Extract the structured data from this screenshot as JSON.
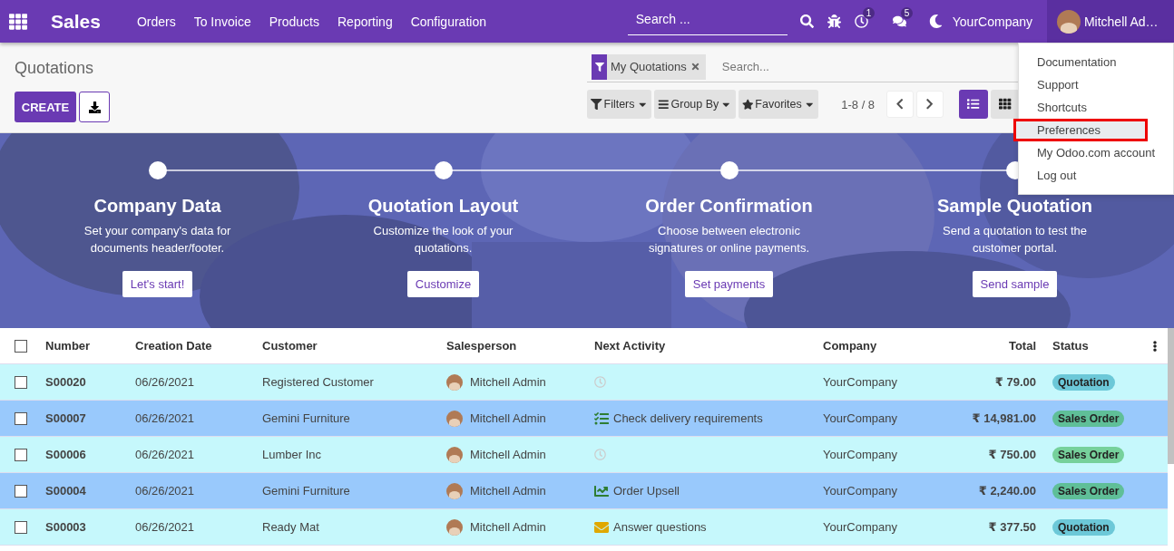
{
  "navbar": {
    "app_name": "Sales",
    "menu": [
      "Orders",
      "To Invoice",
      "Products",
      "Reporting",
      "Configuration"
    ],
    "search": {
      "placeholder": "Search ..."
    },
    "activity_count": "1",
    "message_count": "5",
    "company": "YourCompany",
    "user": "Mitchell Ad…"
  },
  "user_menu": [
    {
      "label": "Documentation",
      "selected": false
    },
    {
      "label": "Support",
      "selected": false
    },
    {
      "label": "Shortcuts",
      "selected": false
    },
    {
      "label": "Preferences",
      "selected": true
    },
    {
      "label": "My Odoo.com account",
      "selected": false
    },
    {
      "label": "Log out",
      "selected": false
    }
  ],
  "control_panel": {
    "title": "Quotations",
    "create_button": "CREATE",
    "facet": "My Quotations",
    "search_placeholder": "Search...",
    "filters": [
      "Filters",
      "Group By",
      "Favorites"
    ],
    "pager": "1-8 / 8",
    "views": [
      {
        "kind": "list",
        "selected": true
      },
      {
        "kind": "kanban",
        "selected": false
      }
    ]
  },
  "onboarding_steps": [
    {
      "title": "Company Data",
      "description": "Set your company's data for documents header/footer.",
      "button": "Let's start!"
    },
    {
      "title": "Quotation Layout",
      "description": "Customize the look of your quotations.",
      "button": "Customize"
    },
    {
      "title": "Order Confirmation",
      "description": "Choose between electronic signatures or online payments.",
      "button": "Set payments"
    },
    {
      "title": "Sample Quotation",
      "description": "Send a quotation to test the customer portal.",
      "button": "Send sample"
    }
  ],
  "table": {
    "select_all_checked": false,
    "columns": [
      "Number",
      "Creation Date",
      "Customer",
      "Salesperson",
      "Next Activity",
      "Company",
      "Total",
      "Status"
    ],
    "rows": [
      {
        "checked": false,
        "number": "S00020",
        "date": "06/26/2021",
        "customer": "Registered Customer",
        "salesperson": "Mitchell Admin",
        "activity": {
          "kind": "none"
        },
        "company": "YourCompany",
        "total": "₹ 79.00",
        "status": {
          "label": "Quotation",
          "color": "#6cc8d8"
        }
      },
      {
        "checked": false,
        "number": "S00007",
        "date": "06/26/2021",
        "customer": "Gemini Furniture",
        "salesperson": "Mitchell Admin",
        "activity": {
          "kind": "todo",
          "label": "Check delivery requirements"
        },
        "company": "YourCompany",
        "total": "₹ 14,981.00",
        "status": {
          "label": "Sales Order",
          "color": "#5fbf98"
        }
      },
      {
        "checked": false,
        "number": "S00006",
        "date": "06/26/2021",
        "customer": "Lumber Inc",
        "salesperson": "Mitchell Admin",
        "activity": {
          "kind": "none"
        },
        "company": "YourCompany",
        "total": "₹ 750.00",
        "status": {
          "label": "Sales Order",
          "color": "#76d19b"
        }
      },
      {
        "checked": false,
        "number": "S00004",
        "date": "06/26/2021",
        "customer": "Gemini Furniture",
        "salesperson": "Mitchell Admin",
        "activity": {
          "kind": "upsell",
          "label": "Order Upsell"
        },
        "company": "YourCompany",
        "total": "₹ 2,240.00",
        "status": {
          "label": "Sales Order",
          "color": "#5fbf98"
        }
      },
      {
        "checked": false,
        "number": "S00003",
        "date": "06/26/2021",
        "customer": "Ready Mat",
        "salesperson": "Mitchell Admin",
        "activity": {
          "kind": "email",
          "label": "Answer questions"
        },
        "company": "YourCompany",
        "total": "₹ 377.50",
        "status": {
          "label": "Quotation",
          "color": "#6cc8d8"
        }
      }
    ]
  }
}
